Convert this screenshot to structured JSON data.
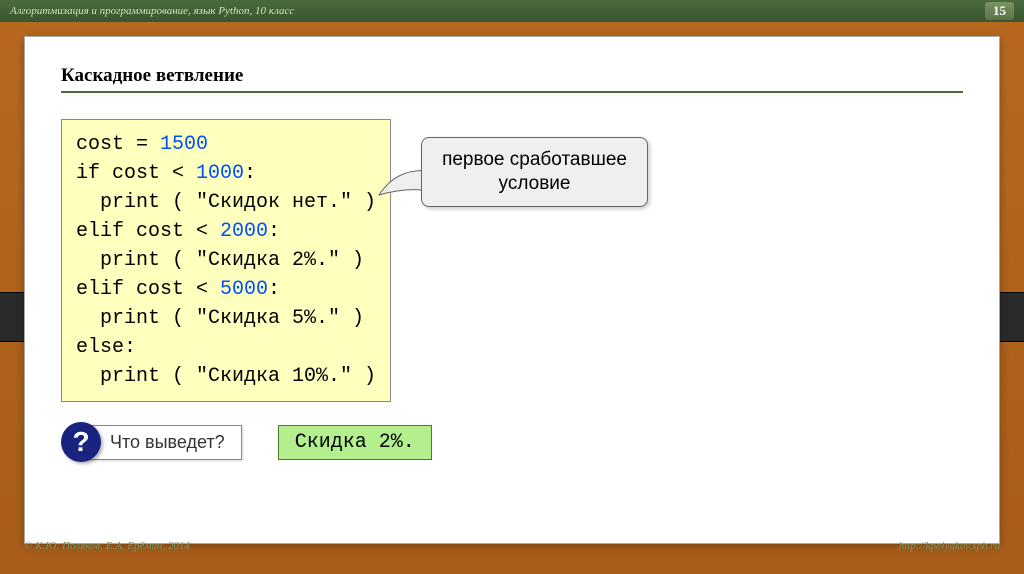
{
  "header": {
    "subject": "Алгоритмизация и программирование, язык Python, 10 класс",
    "page_number": "15"
  },
  "slide": {
    "title": "Каскадное ветвление",
    "code_tokens": {
      "l1a": "cost = ",
      "l1n": "1500",
      "l2a": "if cost < ",
      "l2n": "1000",
      "l2b": ":",
      "l3": "  print ( \"Скидок нет.\" )",
      "l4a": "elif cost < ",
      "l4n": "2000",
      "l4b": ":",
      "l5": "  print ( \"Скидка 2%.\" )",
      "l6a": "elif cost < ",
      "l6n": "5000",
      "l6b": ":",
      "l7": "  print ( \"Скидка 5%.\" )",
      "l8": "else:",
      "l9": "  print ( \"Скидка 10%.\" )"
    },
    "callout_line1": "первое сработавшее",
    "callout_line2": "условие",
    "question_mark": "?",
    "question_label": "Что выведет?",
    "answer": "Скидка 2%."
  },
  "footer": {
    "left": "© К.Ю. Поляков, Е.А. Ерёмин, 2014",
    "right": "http://kpolyakov.spb.ru"
  }
}
